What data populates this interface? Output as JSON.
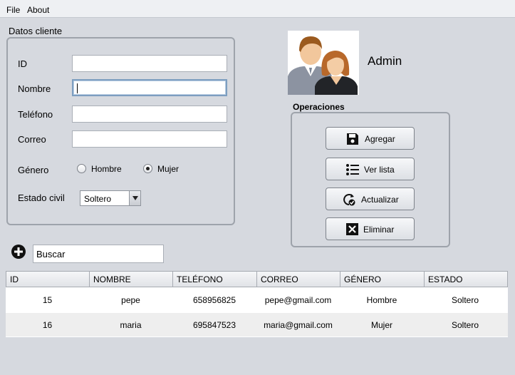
{
  "menu": {
    "items": [
      "File",
      "About"
    ]
  },
  "client_form": {
    "title": "Datos cliente",
    "id_label": "ID",
    "id_value": "",
    "nombre_label": "Nombre",
    "nombre_value": "",
    "telefono_label": "Teléfono",
    "telefono_value": "",
    "correo_label": "Correo",
    "correo_value": "",
    "genero_label": "Género",
    "genero_options": [
      "Hombre",
      "Mujer"
    ],
    "genero_selected": "Mujer",
    "estado_label": "Estado civil",
    "estado_value": "Soltero"
  },
  "user": {
    "name": "Admin"
  },
  "operations": {
    "title": "Operaciones",
    "buttons": [
      "Agregar",
      "Ver lista",
      "Actualizar",
      "Eliminar"
    ]
  },
  "search": {
    "value": "Buscar"
  },
  "table": {
    "columns": [
      "ID",
      "NOMBRE",
      "TELÉFONO",
      "CORREO",
      "GÉNERO",
      "ESTADO"
    ],
    "rows": [
      [
        "15",
        "pepe",
        "658956825",
        "pepe@gmail.com",
        "Hombre",
        "Soltero"
      ],
      [
        "16",
        "maria",
        "695847523",
        "maria@gmail.com",
        "Mujer",
        "Soltero"
      ]
    ]
  }
}
